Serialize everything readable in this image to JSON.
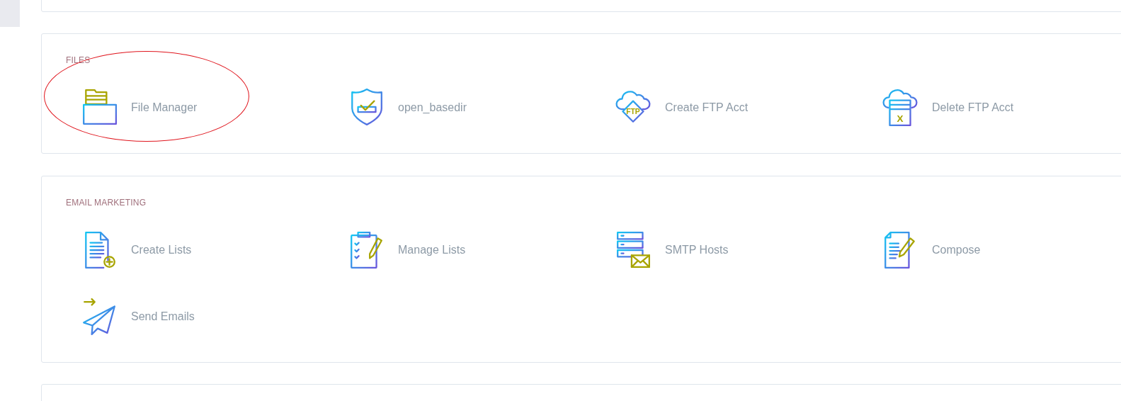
{
  "sections": [
    {
      "heading": "FILES",
      "rows": [
        [
          {
            "label": "File Manager",
            "kind": "folder-drawer",
            "highlighted": true
          },
          {
            "label": "open_basedir",
            "kind": "shield-check",
            "highlighted": false
          },
          {
            "label": "Create FTP Acct",
            "kind": "cloud-ftp",
            "icon_text": "FTP",
            "highlighted": false
          },
          {
            "label": "Delete FTP Acct",
            "kind": "cloud-folder-x",
            "icon_text": "X",
            "highlighted": false
          }
        ]
      ]
    },
    {
      "heading": "EMAIL MARKETING",
      "rows": [
        [
          {
            "label": "Create Lists",
            "kind": "document-plus",
            "highlighted": false
          },
          {
            "label": "Manage Lists",
            "kind": "clipboard-pencil",
            "highlighted": false
          },
          {
            "label": "SMTP Hosts",
            "kind": "server-mail",
            "highlighted": false
          },
          {
            "label": "Compose",
            "kind": "document-pencil",
            "highlighted": false
          }
        ],
        [
          {
            "label": "Send Emails",
            "kind": "paper-plane",
            "highlighted": false
          }
        ]
      ]
    }
  ]
}
